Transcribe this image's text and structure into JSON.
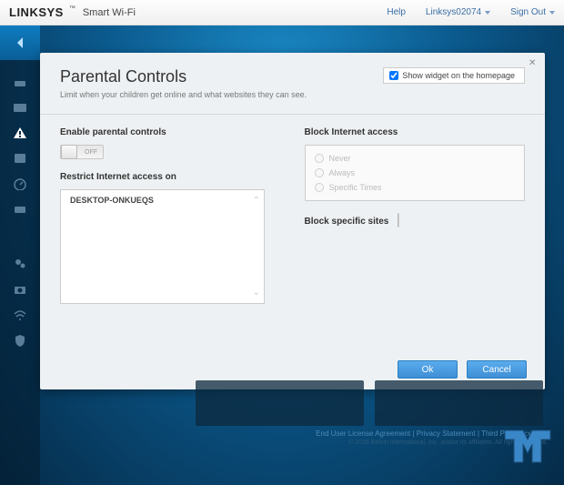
{
  "topbar": {
    "brand": "LINKSYS",
    "brand_sub": "Smart Wi-Fi",
    "help": "Help",
    "account": "Linksys02074",
    "signout": "Sign Out"
  },
  "panel": {
    "title": "Parental Controls",
    "subtitle": "Limit when your children get online and what websites they can see.",
    "widget_label": "Show widget on the homepage",
    "enable_label": "Enable parental controls",
    "toggle_state": "OFF",
    "restrict_label": "Restrict Internet access on",
    "devices": [
      "DESKTOP-ONKUEQS"
    ],
    "block_access_label": "Block Internet access",
    "block_options": [
      "Never",
      "Always",
      "Specific Times"
    ],
    "block_sites_label": "Block specific sites",
    "ok": "Ok",
    "cancel": "Cancel"
  },
  "footer": {
    "eula": "End User License Agreement",
    "privacy": "Privacy Statement",
    "third": "Third Party Licenses",
    "copyright": "© 2016 Belkin International, Inc. and/or its affiliates. All rights reserved."
  }
}
